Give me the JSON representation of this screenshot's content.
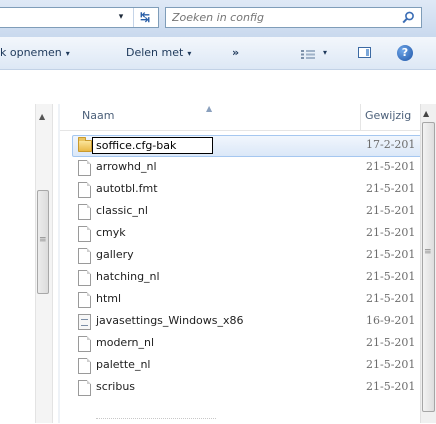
{
  "address": {
    "dropdown_glyph": "▾",
    "refresh_glyph": "↹",
    "search_placeholder": "Zoeken in config",
    "search_icon": "search-icon"
  },
  "toolbar": {
    "include_label": "k opnemen",
    "share_label": "Delen met",
    "more_label": "»",
    "dropdown_glyph": "▾",
    "view_icon": "view-options-icon",
    "preview_icon": "preview-pane-icon",
    "help_label": "?"
  },
  "columns": {
    "name": "Naam",
    "modified": "Gewijzig"
  },
  "files": [
    {
      "name": "soffice.cfg-bak",
      "date": "17-2-201",
      "icon": "folder-icon",
      "renaming": true
    },
    {
      "name": "arrowhd_nl",
      "date": "21-5-201",
      "icon": "file-icon"
    },
    {
      "name": "autotbl.fmt",
      "date": "21-5-201",
      "icon": "file-icon"
    },
    {
      "name": "classic_nl",
      "date": "21-5-201",
      "icon": "file-icon"
    },
    {
      "name": "cmyk",
      "date": "21-5-201",
      "icon": "file-icon"
    },
    {
      "name": "gallery",
      "date": "21-5-201",
      "icon": "file-icon"
    },
    {
      "name": "hatching_nl",
      "date": "21-5-201",
      "icon": "file-icon"
    },
    {
      "name": "html",
      "date": "21-5-201",
      "icon": "file-icon"
    },
    {
      "name": "javasettings_Windows_x86",
      "date": "16-9-201",
      "icon": "settings-file-icon"
    },
    {
      "name": "modern_nl",
      "date": "21-5-201",
      "icon": "file-icon"
    },
    {
      "name": "palette_nl",
      "date": "21-5-201",
      "icon": "file-icon"
    },
    {
      "name": "scribus",
      "date": "21-5-201",
      "icon": "file-icon"
    }
  ],
  "colors": {
    "selection_border": "#a5c7f0",
    "selection_fill": "#dbe8f8",
    "toolbar_text": "#1e395b"
  }
}
